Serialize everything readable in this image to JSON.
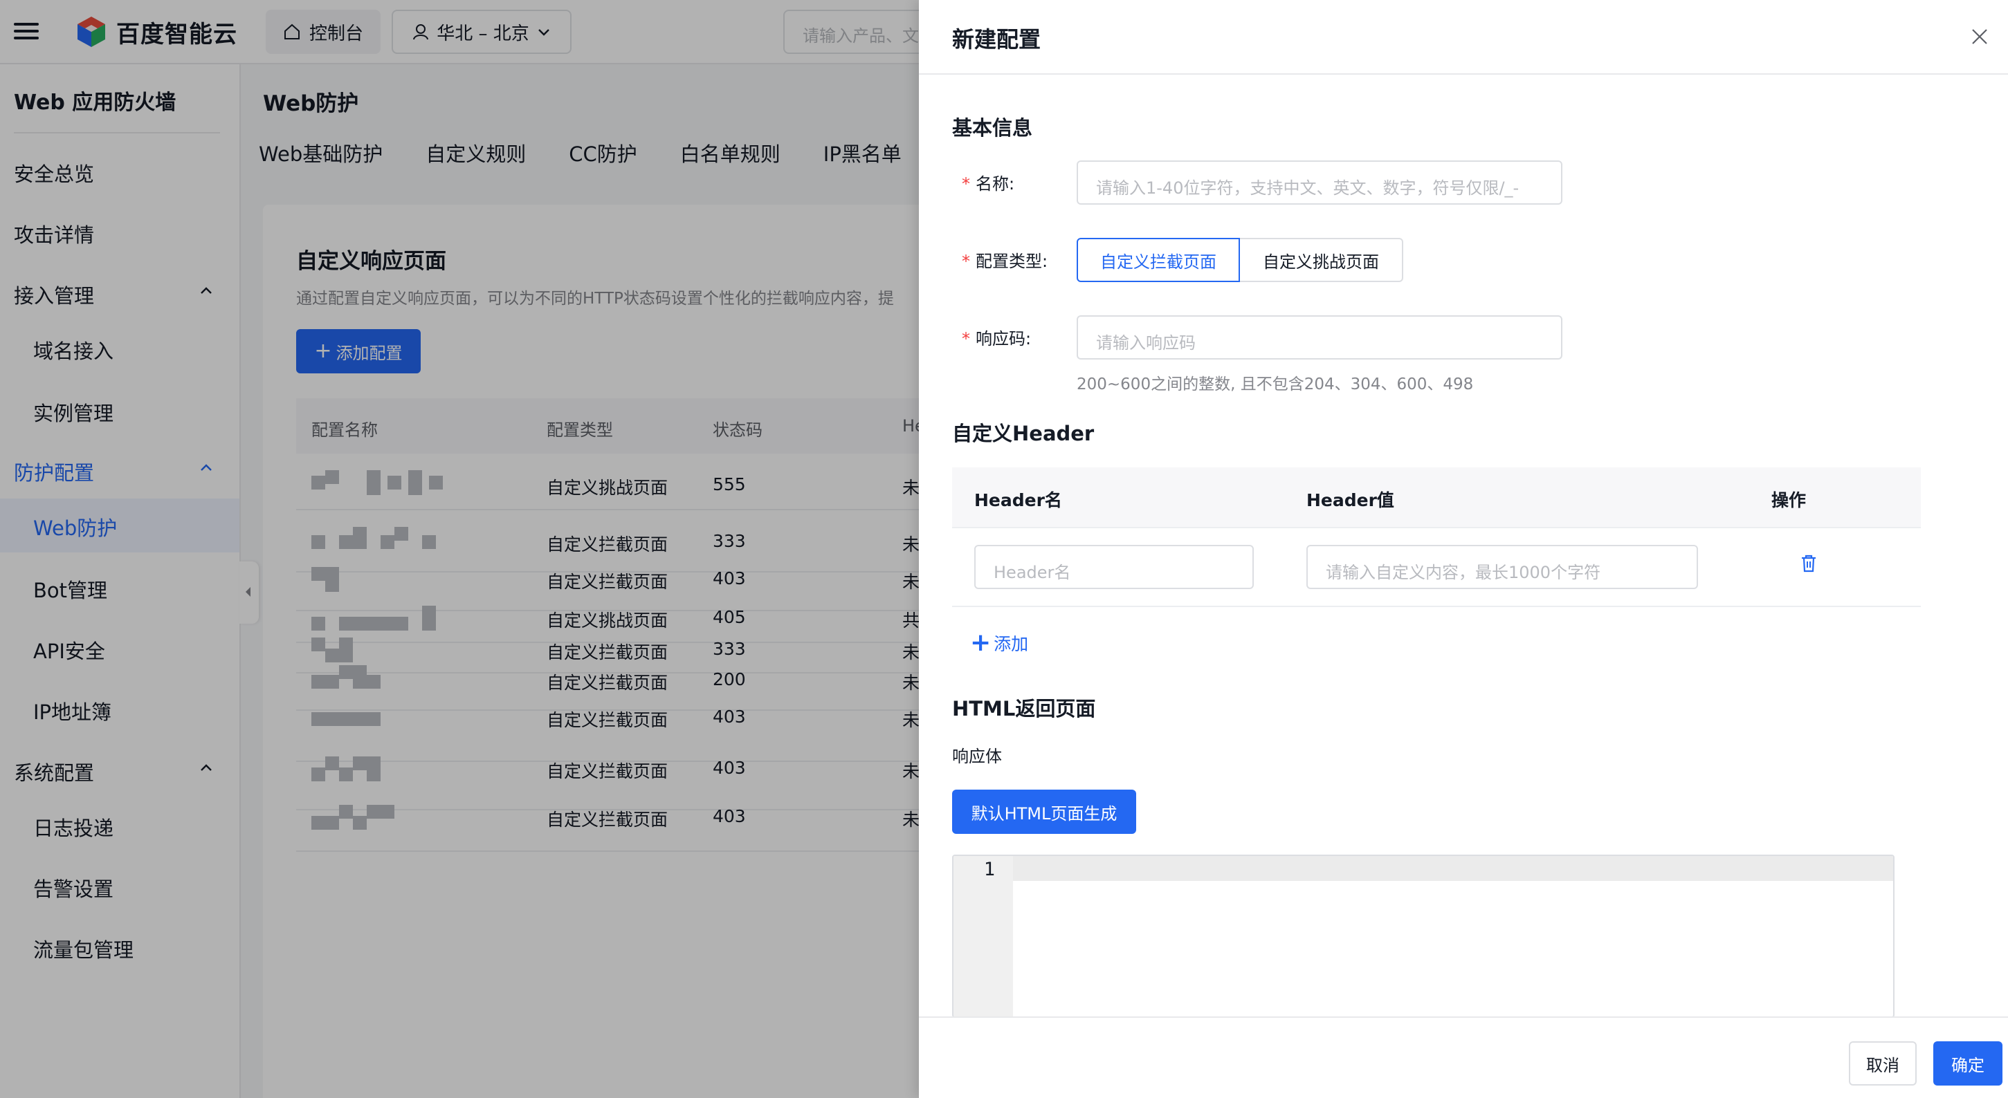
{
  "topbar": {
    "brand": "百度智能云",
    "console_label": "控制台",
    "region_label": "华北 – 北京",
    "search_placeholder": "请输入产品、文"
  },
  "sidebar": {
    "title": "Web 应用防火墙",
    "items": {
      "overview": "安全总览",
      "attack_details": "攻击详情",
      "access_mgmt": "接入管理",
      "domain_access": "域名接入",
      "instance_mgmt": "实例管理",
      "protection_config": "防护配置",
      "web_protection": "Web防护",
      "bot_mgmt": "Bot管理",
      "api_security": "API安全",
      "ip_book": "IP地址簿",
      "system_config": "系统配置",
      "log_delivery": "日志投递",
      "alert_settings": "告警设置",
      "traffic_pack": "流量包管理"
    }
  },
  "main": {
    "title": "Web防护",
    "tabs": [
      "Web基础防护",
      "自定义规则",
      "CC防护",
      "白名单规则",
      "IP黑名单"
    ],
    "card_title": "自定义响应页面",
    "card_desc": "通过配置自定义响应页面，可以为不同的HTTP状态码设置个性化的拦截响应内容，提",
    "add_button": "添加配置",
    "columns": [
      "配置名称",
      "配置类型",
      "状态码",
      "He"
    ],
    "rows": [
      {
        "type": "自定义挑战页面",
        "code": "555",
        "more": "未"
      },
      {
        "type": "自定义拦截页面",
        "code": "333",
        "more": "未"
      },
      {
        "type": "自定义拦截页面",
        "code": "403",
        "more": "未"
      },
      {
        "type": "自定义挑战页面",
        "code": "405",
        "more": "共"
      },
      {
        "type": "自定义拦截页面",
        "code": "333",
        "more": "未"
      },
      {
        "type": "自定义拦截页面",
        "code": "200",
        "more": "未"
      },
      {
        "type": "自定义拦截页面",
        "code": "403",
        "more": "未"
      },
      {
        "type": "自定义拦截页面",
        "code": "403",
        "more": "未"
      },
      {
        "type": "自定义拦截页面",
        "code": "403",
        "more": "未"
      }
    ]
  },
  "drawer": {
    "title": "新建配置",
    "basic_section": "基本信息",
    "name_label": "名称:",
    "name_placeholder": "请输入1-40位字符，支持中文、英文、数字，符号仅限/_-",
    "type_label": "配置类型:",
    "type_options": [
      "自定义拦截页面",
      "自定义挑战页面"
    ],
    "type_selected": "自定义拦截页面",
    "code_label": "响应码:",
    "code_placeholder": "请输入响应码",
    "code_hint": "200~600之间的整数, 且不包含204、304、600、498",
    "header_section": "自定义Header",
    "header_cols": [
      "Header名",
      "Header值",
      "操作"
    ],
    "header_name_placeholder": "Header名",
    "header_value_placeholder": "请输入自定义内容，最长1000个字符",
    "add_label": "添加",
    "html_section": "HTML返回页面",
    "body_label": "响应体",
    "generate_button": "默认HTML页面生成",
    "editor_line": "1",
    "cancel": "取消",
    "confirm": "确定"
  },
  "colors": {
    "primary": "#2468f2",
    "required": "#f33e3e"
  }
}
